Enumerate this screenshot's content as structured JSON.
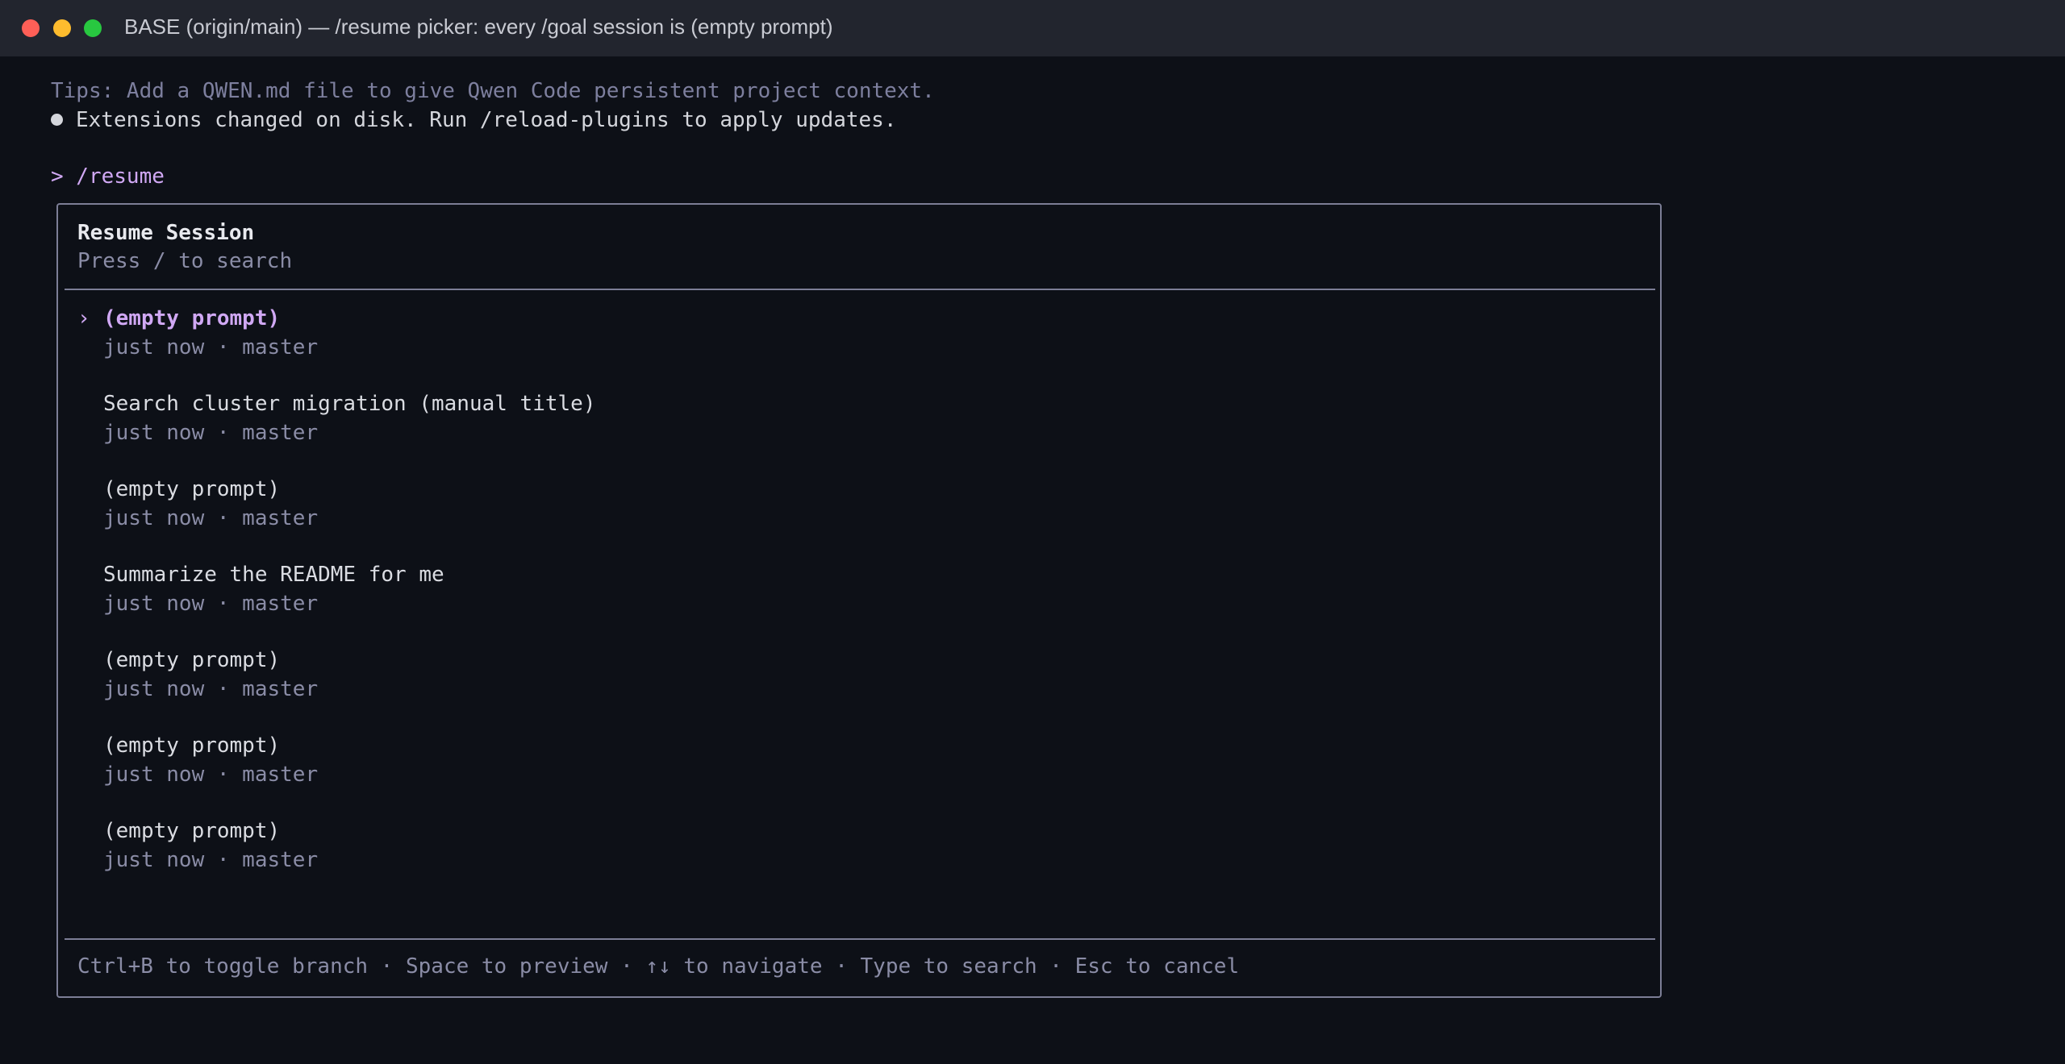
{
  "window": {
    "title": "BASE (origin/main) — /resume picker: every /goal session is (empty prompt)"
  },
  "terminal": {
    "tips": "Tips: Add a QWEN.md file to give Qwen Code persistent project context.",
    "notice": "Extensions changed on disk. Run /reload-plugins to apply updates.",
    "prompt": "> /resume"
  },
  "picker": {
    "title": "Resume Session",
    "hint": "Press / to search",
    "pointer": "›",
    "sessions": [
      {
        "title": "(empty prompt)",
        "meta": "just now · master",
        "selected": true
      },
      {
        "title": "Search cluster migration (manual title)",
        "meta": "just now · master",
        "selected": false
      },
      {
        "title": "(empty prompt)",
        "meta": "just now · master",
        "selected": false
      },
      {
        "title": "Summarize the README for me",
        "meta": "just now · master",
        "selected": false
      },
      {
        "title": "(empty prompt)",
        "meta": "just now · master",
        "selected": false
      },
      {
        "title": "(empty prompt)",
        "meta": "just now · master",
        "selected": false
      },
      {
        "title": "(empty prompt)",
        "meta": "just now · master",
        "selected": false
      }
    ],
    "footer": "Ctrl+B to toggle branch · Space to preview · ↑↓ to navigate · Type to search · Esc to cancel"
  },
  "colors": {
    "background": "#0d1017",
    "titlebar": "#22252e",
    "accent": "#d0a8f4",
    "muted": "#8a8ca6",
    "border": "#7c7e96"
  }
}
